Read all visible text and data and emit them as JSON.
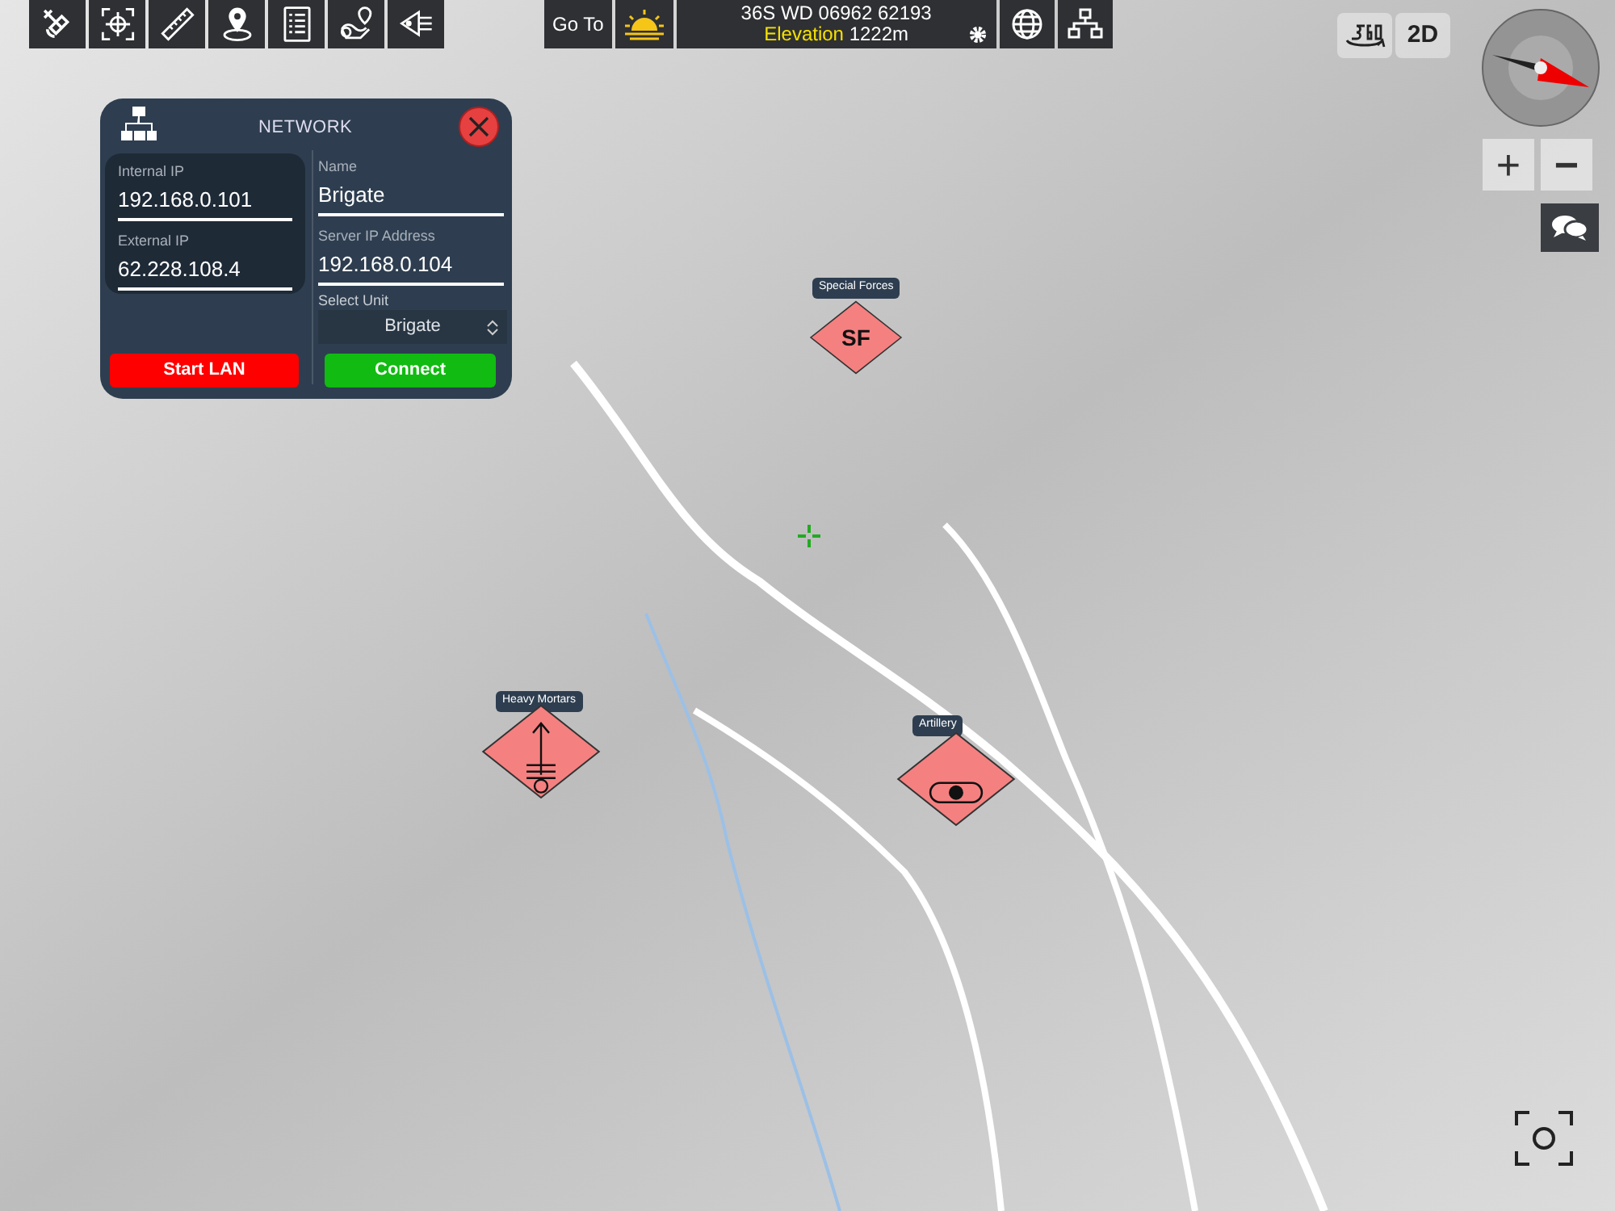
{
  "toolbar": {
    "goto_label": "Go To",
    "grid_reference": "36S WD 06962 62193",
    "elevation_label": "Elevation",
    "elevation_value": "1222m"
  },
  "view_controls": {
    "mode_label": "2D",
    "zoom_in": "+",
    "zoom_out": "−"
  },
  "network_panel": {
    "title": "NETWORK",
    "left_fields": [
      {
        "label": "Internal IP",
        "value": "192.168.0.101"
      },
      {
        "label": "External IP",
        "value": "62.228.108.4"
      }
    ],
    "right_fields": [
      {
        "label": "Name",
        "value": "Brigate"
      },
      {
        "label": "Server IP Address",
        "value": "192.168.0.104"
      }
    ],
    "select": {
      "label": "Select Unit",
      "value": "Brigate"
    },
    "buttons": [
      {
        "label": "Start LAN",
        "kind": "danger"
      },
      {
        "label": "Connect",
        "kind": "success"
      }
    ]
  },
  "units": [
    {
      "label": "Special Forces",
      "kind": "text",
      "symbol": "SF"
    },
    {
      "label": "Heavy Mortars",
      "kind": "mortar"
    },
    {
      "label": "Artillery",
      "kind": "artillery"
    }
  ]
}
